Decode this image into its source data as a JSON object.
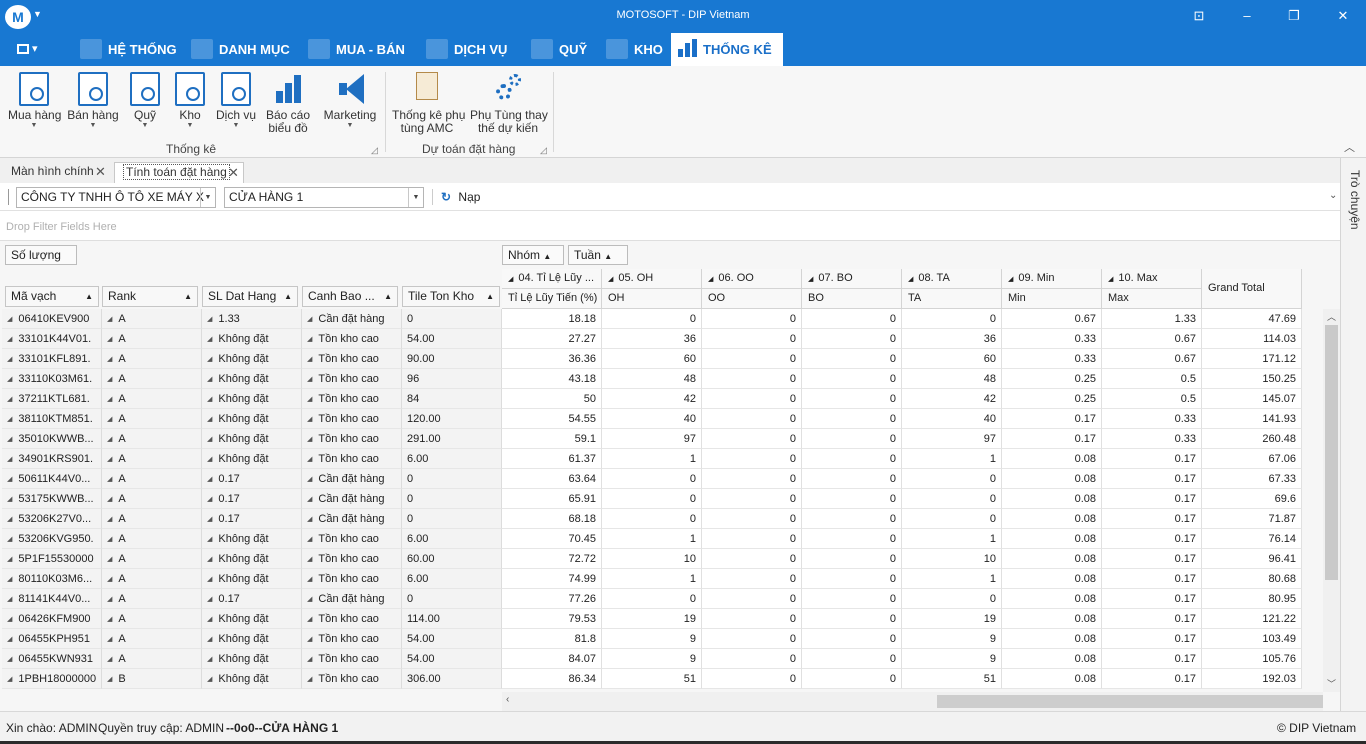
{
  "window": {
    "title": "MOTOSOFT - DIP Vietnam",
    "logo_glyph": "M",
    "accent": "#1878d2"
  },
  "menu": {
    "tabs": [
      {
        "label": "HỆ THỐNG"
      },
      {
        "label": "DANH MỤC"
      },
      {
        "label": "MUA - BÁN"
      },
      {
        "label": "DỊCH VỤ"
      },
      {
        "label": "QUỸ"
      },
      {
        "label": "KHO"
      },
      {
        "label": "THỐNG KÊ"
      }
    ],
    "active": "THỐNG KÊ"
  },
  "ribbon": {
    "group1": {
      "name": "Thống kê",
      "buttons": [
        {
          "l1": "Mua hàng"
        },
        {
          "l1": "Bán hàng"
        },
        {
          "l1": "Quỹ"
        },
        {
          "l1": "Kho"
        },
        {
          "l1": "Dịch vụ"
        },
        {
          "l1": "Báo cáo",
          "l2": "biểu đồ"
        },
        {
          "l1": "Marketing"
        }
      ]
    },
    "group2": {
      "name": "Dự toán đặt hàng",
      "buttons": [
        {
          "l1": "Thống kê phụ",
          "l2": "tùng AMC"
        },
        {
          "l1": "Phụ Tùng thay",
          "l2": "thế dự kiến"
        }
      ]
    }
  },
  "doc_tabs": [
    "Màn hình chính",
    "Tính toán đặt hàng"
  ],
  "toolbar": {
    "company": "CÔNG TY TNHH Ô TÔ XE MÁY X",
    "store": "CỬA HÀNG 1",
    "reload": "Nạp"
  },
  "filter_placeholder": "Drop Filter Fields Here",
  "pivot": {
    "data_field": "Số lượng",
    "column_fields": [
      "Nhóm",
      "Tuần"
    ],
    "row_fields": [
      "Mã vạch",
      "Rank",
      "SL Dat Hang",
      "Canh Bao ...",
      "Tile Ton Kho"
    ],
    "groups": [
      {
        "top": "04. Tỉ Lệ Lũy ...",
        "sub": "Tỉ Lệ Lũy Tiến (%)"
      },
      {
        "top": "05. OH",
        "sub": "OH"
      },
      {
        "top": "06. OO",
        "sub": "OO"
      },
      {
        "top": "07. BO",
        "sub": "BO"
      },
      {
        "top": "08. TA",
        "sub": "TA"
      },
      {
        "top": "09. Min",
        "sub": "Min"
      },
      {
        "top": "10. Max",
        "sub": "Max"
      }
    ],
    "grand_total": "Grand Total",
    "rows": [
      {
        "code": "06410KEV900",
        "rank": "A",
        "sl": "1.33",
        "cb": "Cần đặt hàng",
        "tl": "0",
        "v": [
          "18.18",
          "0",
          "0",
          "0",
          "0",
          "0.67",
          "1.33",
          "47.69"
        ]
      },
      {
        "code": "33101K44V01.",
        "rank": "A",
        "sl": "Không đặt",
        "cb": "Tồn kho cao",
        "tl": "54.00",
        "v": [
          "27.27",
          "36",
          "0",
          "0",
          "36",
          "0.33",
          "0.67",
          "114.03"
        ]
      },
      {
        "code": "33101KFL891.",
        "rank": "A",
        "sl": "Không đặt",
        "cb": "Tồn kho cao",
        "tl": "90.00",
        "v": [
          "36.36",
          "60",
          "0",
          "0",
          "60",
          "0.33",
          "0.67",
          "171.12"
        ]
      },
      {
        "code": "33110K03M61.",
        "rank": "A",
        "sl": "Không đặt",
        "cb": "Tồn kho cao",
        "tl": "96",
        "v": [
          "43.18",
          "48",
          "0",
          "0",
          "48",
          "0.25",
          "0.5",
          "150.25"
        ]
      },
      {
        "code": "37211KTL681.",
        "rank": "A",
        "sl": "Không đặt",
        "cb": "Tồn kho cao",
        "tl": "84",
        "v": [
          "50",
          "42",
          "0",
          "0",
          "42",
          "0.25",
          "0.5",
          "145.07"
        ]
      },
      {
        "code": "38110KTM851.",
        "rank": "A",
        "sl": "Không đặt",
        "cb": "Tồn kho cao",
        "tl": "120.00",
        "v": [
          "54.55",
          "40",
          "0",
          "0",
          "40",
          "0.17",
          "0.33",
          "141.93"
        ]
      },
      {
        "code": "35010KWWB...",
        "rank": "A",
        "sl": "Không đặt",
        "cb": "Tồn kho cao",
        "tl": "291.00",
        "v": [
          "59.1",
          "97",
          "0",
          "0",
          "97",
          "0.17",
          "0.33",
          "260.48"
        ]
      },
      {
        "code": "34901KRS901.",
        "rank": "A",
        "sl": "Không đặt",
        "cb": "Tồn kho cao",
        "tl": "6.00",
        "v": [
          "61.37",
          "1",
          "0",
          "0",
          "1",
          "0.08",
          "0.17",
          "67.06"
        ]
      },
      {
        "code": "50611K44V0...",
        "rank": "A",
        "sl": "0.17",
        "cb": "Cần đặt hàng",
        "tl": "0",
        "v": [
          "63.64",
          "0",
          "0",
          "0",
          "0",
          "0.08",
          "0.17",
          "67.33"
        ]
      },
      {
        "code": "53175KWWB...",
        "rank": "A",
        "sl": "0.17",
        "cb": "Cần đặt hàng",
        "tl": "0",
        "v": [
          "65.91",
          "0",
          "0",
          "0",
          "0",
          "0.08",
          "0.17",
          "69.6"
        ]
      },
      {
        "code": "53206K27V0...",
        "rank": "A",
        "sl": "0.17",
        "cb": "Cần đặt hàng",
        "tl": "0",
        "v": [
          "68.18",
          "0",
          "0",
          "0",
          "0",
          "0.08",
          "0.17",
          "71.87"
        ]
      },
      {
        "code": "53206KVG950.",
        "rank": "A",
        "sl": "Không đặt",
        "cb": "Tồn kho cao",
        "tl": "6.00",
        "v": [
          "70.45",
          "1",
          "0",
          "0",
          "1",
          "0.08",
          "0.17",
          "76.14"
        ]
      },
      {
        "code": "5P1F15530000",
        "rank": "A",
        "sl": "Không đặt",
        "cb": "Tồn kho cao",
        "tl": "60.00",
        "v": [
          "72.72",
          "10",
          "0",
          "0",
          "10",
          "0.08",
          "0.17",
          "96.41"
        ]
      },
      {
        "code": "80110K03M6...",
        "rank": "A",
        "sl": "Không đặt",
        "cb": "Tồn kho cao",
        "tl": "6.00",
        "v": [
          "74.99",
          "1",
          "0",
          "0",
          "1",
          "0.08",
          "0.17",
          "80.68"
        ]
      },
      {
        "code": "81141K44V0...",
        "rank": "A",
        "sl": "0.17",
        "cb": "Cần đặt hàng",
        "tl": "0",
        "v": [
          "77.26",
          "0",
          "0",
          "0",
          "0",
          "0.08",
          "0.17",
          "80.95"
        ]
      },
      {
        "code": "06426KFM900",
        "rank": "A",
        "sl": "Không đặt",
        "cb": "Tồn kho cao",
        "tl": "114.00",
        "v": [
          "79.53",
          "19",
          "0",
          "0",
          "19",
          "0.08",
          "0.17",
          "121.22"
        ]
      },
      {
        "code": "06455KPH951",
        "rank": "A",
        "sl": "Không đặt",
        "cb": "Tồn kho cao",
        "tl": "54.00",
        "v": [
          "81.8",
          "9",
          "0",
          "0",
          "9",
          "0.08",
          "0.17",
          "103.49"
        ]
      },
      {
        "code": "06455KWN931",
        "rank": "A",
        "sl": "Không đặt",
        "cb": "Tồn kho cao",
        "tl": "54.00",
        "v": [
          "84.07",
          "9",
          "0",
          "0",
          "9",
          "0.08",
          "0.17",
          "105.76"
        ]
      },
      {
        "code": "1PBH18000000",
        "rank": "B",
        "sl": "Không đặt",
        "cb": "Tồn kho cao",
        "tl": "306.00",
        "v": [
          "86.34",
          "51",
          "0",
          "0",
          "51",
          "0.08",
          "0.17",
          "192.03"
        ]
      }
    ]
  },
  "side_panel": "Trò chuyện",
  "status": {
    "greeting": "Xin chào: ADMIN",
    "access": "Quyền truy cập: ADMIN",
    "store": "--0o0--CỬA HÀNG 1",
    "copyright": "© DIP Vietnam"
  }
}
